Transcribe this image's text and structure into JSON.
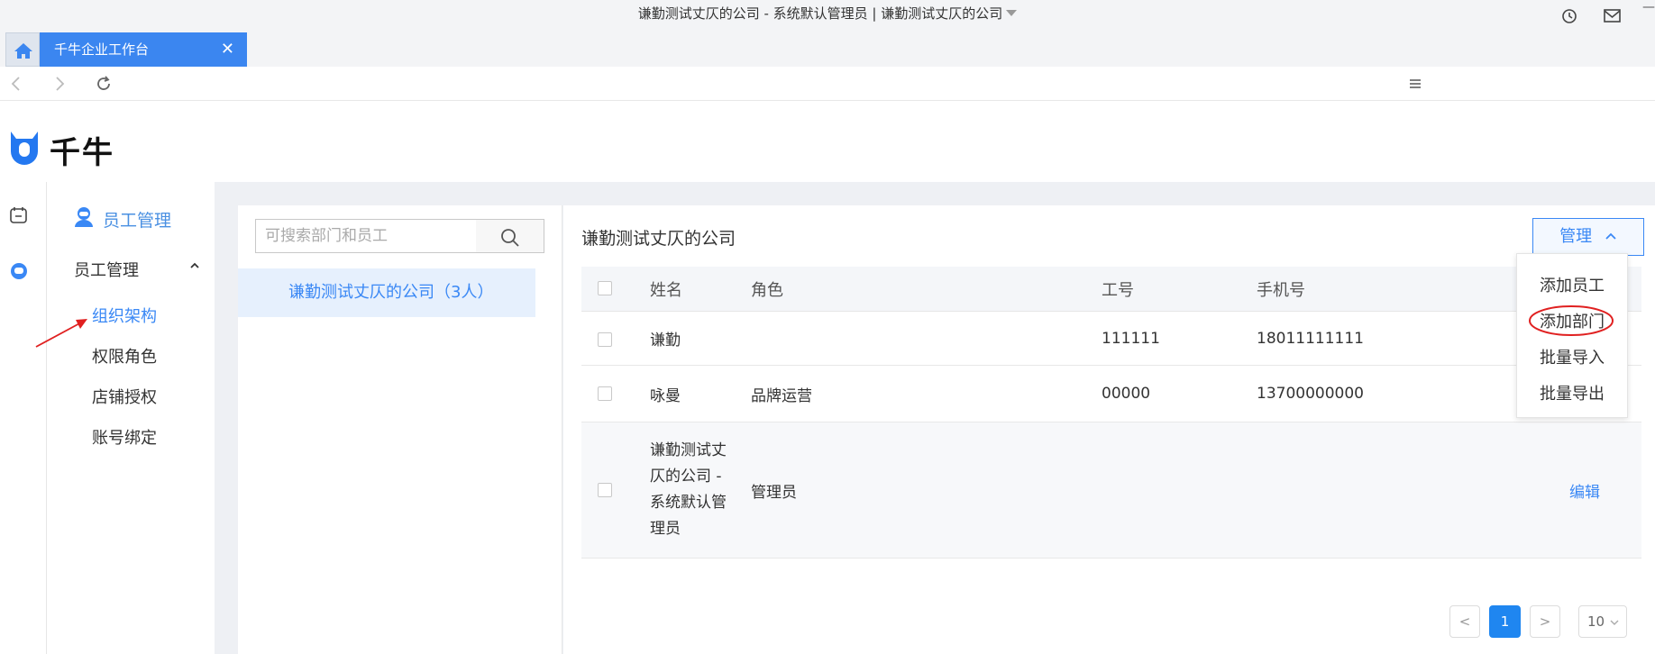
{
  "window": {
    "title": "谦勤测试丈仄的公司 - 系统默认管理员 | 谦勤测试丈仄的公司",
    "minimize_label": "—"
  },
  "tabs": {
    "active_label": "千牛企业工作台",
    "close_label": "✕"
  },
  "app": {
    "logo_text": "千牛"
  },
  "side_nav": {
    "section_title": "员工管理",
    "group_label": "员工管理",
    "items": [
      {
        "label": "组织架构",
        "active": true
      },
      {
        "label": "权限角色",
        "active": false
      },
      {
        "label": "店铺授权",
        "active": false
      },
      {
        "label": "账号绑定",
        "active": false
      }
    ]
  },
  "dept_panel": {
    "search_placeholder": "可搜索部门和员工",
    "selected_dept": "谦勤测试丈仄的公司（3人）"
  },
  "staff_panel": {
    "company_name": "谦勤测试丈仄的公司",
    "manage_label": "管理",
    "columns": [
      "姓名",
      "角色",
      "工号",
      "手机号"
    ],
    "rows": [
      {
        "name": "谦勤",
        "role": "",
        "id": "111111",
        "phone": "18011111111",
        "action": ""
      },
      {
        "name": "咏曼",
        "role": "品牌运营",
        "id": "00000",
        "phone": "13700000000",
        "action": ""
      },
      {
        "name": "谦勤测试丈仄的公司 - 系统默认管理员",
        "role": "管理员",
        "id": "",
        "phone": "",
        "action": "编辑"
      }
    ],
    "manage_menu": [
      "添加员工",
      "添加部门",
      "批量导入",
      "批量导出"
    ],
    "highlighted_menu_item": "添加部门"
  },
  "pagination": {
    "prev": "<",
    "current": "1",
    "next": ">",
    "page_size": "10"
  },
  "colors": {
    "accent": "#3a88f5",
    "tab_active": "#3b86f0",
    "annotation_red": "#e02020"
  }
}
